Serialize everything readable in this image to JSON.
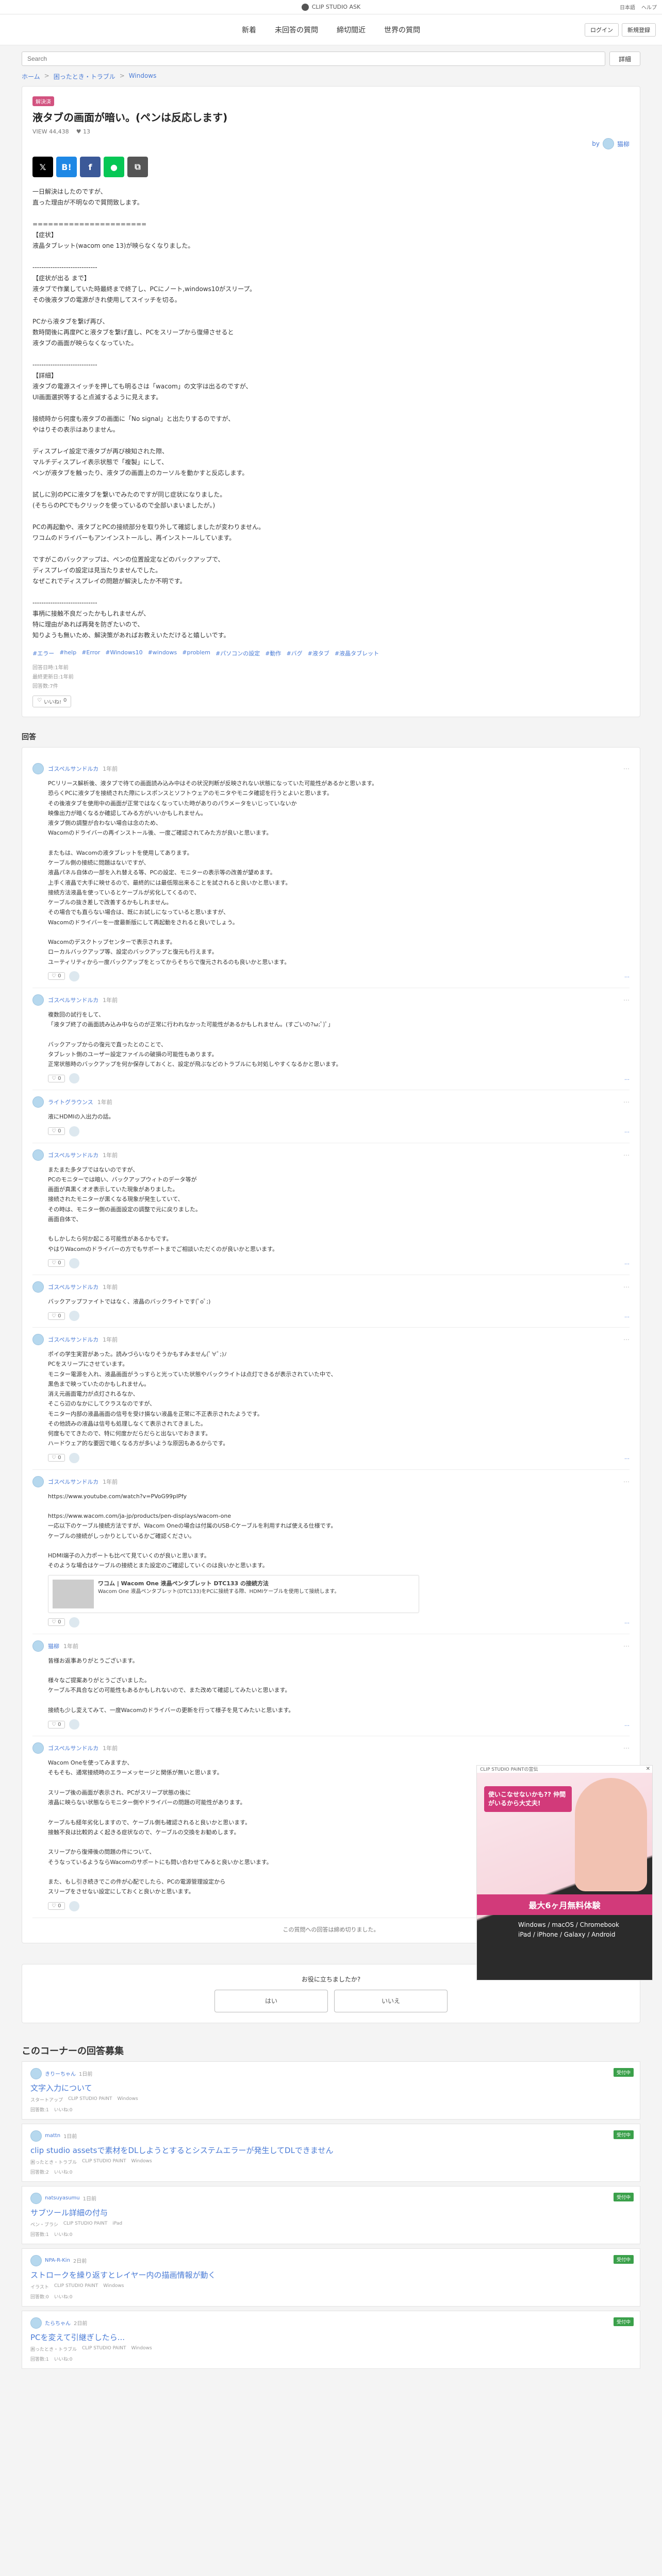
{
  "site": {
    "brand": "CLIP STUDIO ASK",
    "top_links": [
      "日本語",
      "ヘルプ"
    ]
  },
  "nav": {
    "items": [
      "新着",
      "未回答の質問",
      "締切間近",
      "世界の質問"
    ],
    "login": "ログイン",
    "register": "新規登録"
  },
  "search": {
    "placeholder": "Search",
    "button": "詳細"
  },
  "breadcrumb": [
    "ホーム",
    "困ったとき・トラブル",
    "Windows"
  ],
  "question": {
    "badge": "解決済",
    "title": "液タブの画面が暗い。(ペンは反応します)",
    "views_label": "VIEW",
    "views": "44,438",
    "likes": "13",
    "author": "猫柳",
    "body": "一日解決はしたのですが、\n直った理由が不明なので質問致します。\n\n======================\n【症状】\n液晶タブレット(wacom one 13)が映らなくなりました。\n\n-----------------------------\n【症状が出る まで】\n液タブで作業していた時最終まで終了し、PCにノート,windows10がスリープ。\nその後液タブの電源がきれ使用してスイッチを切る。\n\nPCから液タブを繋げ再び、\n数時間後に再度PCと液タブを繋げ直し、PCをスリープから復帰させると\n液タブの画面が映らなくなっていた。\n\n-----------------------------\n【詳細】\n液タブの電源スイッチを押しても明るさは「wacom」の文字は出るのですが、\nUI画面選択等すると点滅するように見えます。\n\n接続時から何度も液タブの画面に「No signal」と出たりするのですが、\nやはりその表示はありません。\n\nディスプレイ設定で液タブが再び検知された際、\nマルチディスプレイ表示状態で「複製」にして、\nペンが液タブを触ったり、液タブの画面上のカーソルを動かすと反応します。\n\n試しに別のPCに液タブを繋いでみたのですが同じ症状になりました。\n(そちらのPCでもクリックを使っているので全部いまいましたが。)\n\nPCの再起動や、液タブとPCの接続部分を取り外して確認しましたが変わりません。\nワコムのドライバーもアンインストールし、再インストールしています。\n\nですがこのバックアップは、ペンの位置設定などのバックアップで、\nディスプレイの設定は見当たりませんでした。\nなぜこれでディスプレイの問題が解決したか不明です。\n\n-----------------------------\n事柄に接触不良だったかもしれませんが、\n特に理由があれば再発を防ぎたいので、\n知りようも無いため、解決策があればお教えいただけると嬉しいです。",
    "tags": [
      "#エラー",
      "#help",
      "#Error",
      "#Windows10",
      "#windows",
      "#problem",
      "#パソコンの設定",
      "#動作",
      "#バグ",
      "#液タブ",
      "#液晶タブレット"
    ],
    "posted": "回答日時:1年前",
    "updated": "最終更新日:1年前",
    "answers_count": "回答数:7件",
    "like_label": "いいね!",
    "like_count": "0"
  },
  "answers_heading": "回答",
  "answers": [
    {
      "user": "ゴスペルサンドルカ",
      "date": "1年前",
      "body": "PCリリース解析後、液タブで待ての画面読み込み中はその状況判断が反映されない状態になっていた可能性があるかと思います。\n恐らくPCに液タブを接続された際にレスポンスとソフトウェアのモニタやモニタ確認を行うとよいと思います。\nその後液タブを使用中の画面が正常ではなくなっていた時がありのパラメータをいじっていないか\n映像出力が暗くなるか確認してみる方がいいかもしれません。\n液タブ側の調整が合わない場合は念のため、\nWacomのドライバーの再インストール後、一度ご確認されてみた方が良いと思います。\n\nまたもは、Wacomの液タブレットを使用してあります。\nケーブル側の接続に問題はないですが、\n液晶パネル自体の一部を入れ替える等、PCの設定、モニターの表示等の改善が望めます。\n上手く液晶で大手に映せるので、最終的には最低限出来ることを試されると良いかと思います。\n接続方法液晶を使っているとケーブルが劣化してくるので、\nケーブルの抜き差しで改善するかもしれません。\nその場合でも直らない場合は、既にお試しになっていると思いますが、\nWacomのドライバーを一度最新版にして再起動をされると良いでしょう。\n\nWacomのデスクトップセンターで表示されます。\nローカルバックアップ等、設定のバックアップと復元も行えます。\nユーティリティから一度バックアップをとってからそちらで復元されるのも良いかと思います。",
      "likes": "0"
    },
    {
      "user": "ゴスペルサンドルカ",
      "date": "1年前",
      "body": "複数回の試行をして、\n「液タブ終了の画面読み込み中ならのが正常に行われなかった可能性があるかもしれません。(すごいの?ω;ﾟ)ﾟ」\n\nバックアップからの復元で直ったとのことで、\nタブレット側のユーザー設定ファイルの破損の可能性もあります。\n正常状態時のバックアップを何か保存しておくと、設定が飛ぶなどのトラブルにも対処しやすくなるかと思います。",
      "likes": "0"
    },
    {
      "user": "ライトグラウンス",
      "date": "1年前",
      "body": "液にHDMIの入出力の話。",
      "likes": "0"
    },
    {
      "user": "ゴスペルサンドルカ",
      "date": "1年前",
      "body": "またまた多タブではないのですが、\nPCのモニターでは暗い、バックアップウィトのデータ等が\n画面が真黒くオオ表示していた現象がありました。\n接続されたモニターが黒くなる現象が発生していて、\nその時は、モニター側の画面設定の調整で元に戻りました。\n画面自体で、\n\nもしかしたら何か起こる可能性があるかもです。\nやはりWacomのドライバーの方でもサポートまでご相談いただくのが良いかと思います。",
      "likes": "0"
    },
    {
      "user": "ゴスペルサンドルカ",
      "date": "1年前",
      "body": "バックアップファイトではなく、液晶のバックライトです(ﾟoﾟ;)",
      "likes": "0"
    },
    {
      "user": "ゴスペルサンドルカ",
      "date": "1年前",
      "body": "ポイの学生実習があった。読みづらいなりそうかもすみません(ﾟ∀ﾟ;)ﾉ\nPCをスリープにさせています。\nモニター電源を入れ、液晶画面がうっすらと光っていた状態やバックライトは点灯できるが表示されていた中で、\n黒色まで映っていたのかもしれません。\n消え元画面電力が点灯されるなか、\nそこら辺のなかにしてクラスなのですが、\nモニター内部の液晶画面の信号を受け損ない液晶を正常に不正表示されたようです。\nその他読みの液晶は信号も処理しなくて表示されてきました。\n何度もでてきたので、特に何度かだらだらと出ないでおきます。\nハードウェア的な要因で暗くなる方が多いような原因もあるからです。",
      "likes": "0"
    },
    {
      "user": "ゴスペルサンドルカ",
      "date": "1年前",
      "body": "https://www.youtube.com/watch?v=PVoG99pIPfy\n\nhttps://www.wacom.com/ja-jp/products/pen-displays/wacom-one\n一応以下のケーブル接続方法ですが、Wacom Oneの場合は付属のUSB-Cケーブルを利用すれば使える仕様です。\nケーブルの接続がしっかりとしているかご確認ください。\n\nHDMI端子の入力ポートも比べて見ていくのが良いと思います。\nそのような場合はケーブルの接続とまた設定のご確認していくのは良いかと思います。",
      "link": {
        "title": "ワコム | Wacom One 液晶ペンタブレット DTC133 の接続方法",
        "desc": "Wacom One 液晶ペンタブレット(DTC133)をPCに接続する際、HDMIケーブルを使用して接続します。"
      },
      "likes": "0"
    },
    {
      "user": "猫柳",
      "date": "1年前",
      "body": "皆様お返事ありがとうございます。\n\n様々なご提案ありがとうございました。\nケーブル不具合などの可能性もあるかもしれないので、また改めて確認してみたいと思います。\n\n接続も少し変えてみて、一度Wacomのドライバーの更新を行って様子を見てみたいと思います。",
      "likes": "0"
    },
    {
      "user": "ゴスペルサンドルカ",
      "date": "1年前",
      "body": "Wacom Oneを使ってみますか、\nそもそも、通常接続時のエラーメッセージと関係が無いと思います。\n\nスリープ後の画面が表示され、PCがスリープ状態の後に\n液晶に映らない状態ならモニター側やドライバーの問題の可能性があります。\n\nケーブルも経年劣化しますので、ケーブル側も確認されると良いかと思います。\n接触不良は比較的よく起きる症状なので、ケーブルの交換をお勧めします。\n\nスリープから復帰後の問題の件について、\nそうなっているようならWacomのサポートにも問い合わせてみると良いかと思います。\n\nまた、もし引き続きでこの件が心配でしたら、PCの電源管理設定から\nスリープをさせない設定にしておくと良いかと思います。",
      "likes": "0"
    }
  ],
  "closed_note": "この質問への回答は締め切りました。",
  "resolve": {
    "question": "お役に立ちましたか?",
    "yes": "はい",
    "no": "いいえ"
  },
  "related_heading": "このコーナーの回答募集",
  "related": [
    {
      "user": "きりーちゃん",
      "date": "1日前",
      "title": "文字入力について",
      "tags": [
        "スタートアップ",
        "CLIP STUDIO PAINT",
        "Windows"
      ],
      "stats": [
        "回答数:1",
        "いいね:0"
      ],
      "badge": "受付中"
    },
    {
      "user": "mattn",
      "date": "1日前",
      "title": "clip studio assetsで素材をDLしようとするとシステムエラーが発生してDLできません",
      "tags": [
        "困ったとき・トラブル",
        "CLIP STUDIO PAINT",
        "Windows"
      ],
      "stats": [
        "回答数:2",
        "いいね:0"
      ],
      "badge": "受付中"
    },
    {
      "user": "natsuyasumu",
      "date": "1日前",
      "title": "サブツール詳細の付与",
      "tags": [
        "ペン・ブラシ",
        "CLIP STUDIO PAINT",
        "iPad"
      ],
      "stats": [
        "回答数:1",
        "いいね:0"
      ],
      "badge": "受付中"
    },
    {
      "user": "NPA-R-Kin",
      "date": "2日前",
      "title": "ストロークを繰り返すとレイヤー内の描画情報が動く",
      "tags": [
        "イラスト",
        "CLIP STUDIO PAINT",
        "Windows"
      ],
      "stats": [
        "回答数:0",
        "いいね:0"
      ],
      "badge": "受付中"
    },
    {
      "user": "たらちゃん",
      "date": "2日前",
      "title": "PCを変えて引継ぎしたら...",
      "tags": [
        "困ったとき・トラブル",
        "CLIP STUDIO PAINT",
        "Windows"
      ],
      "stats": [
        "回答数:1",
        "いいね:0"
      ],
      "badge": "受付中"
    }
  ],
  "ad": {
    "label": "CLIP STUDIO PAINTの宣伝",
    "headline": "使いこなせないかも?? 仲間がいるから大丈夫!",
    "offer": "最大6ヶ月無料体験",
    "platforms": "Windows / macOS / Chromebook\niPad / iPhone / Galaxy / Android"
  },
  "colors": {
    "accent": "#4a7bd6",
    "badge": "#d2527f",
    "ad_pink": "#d23a7a"
  }
}
